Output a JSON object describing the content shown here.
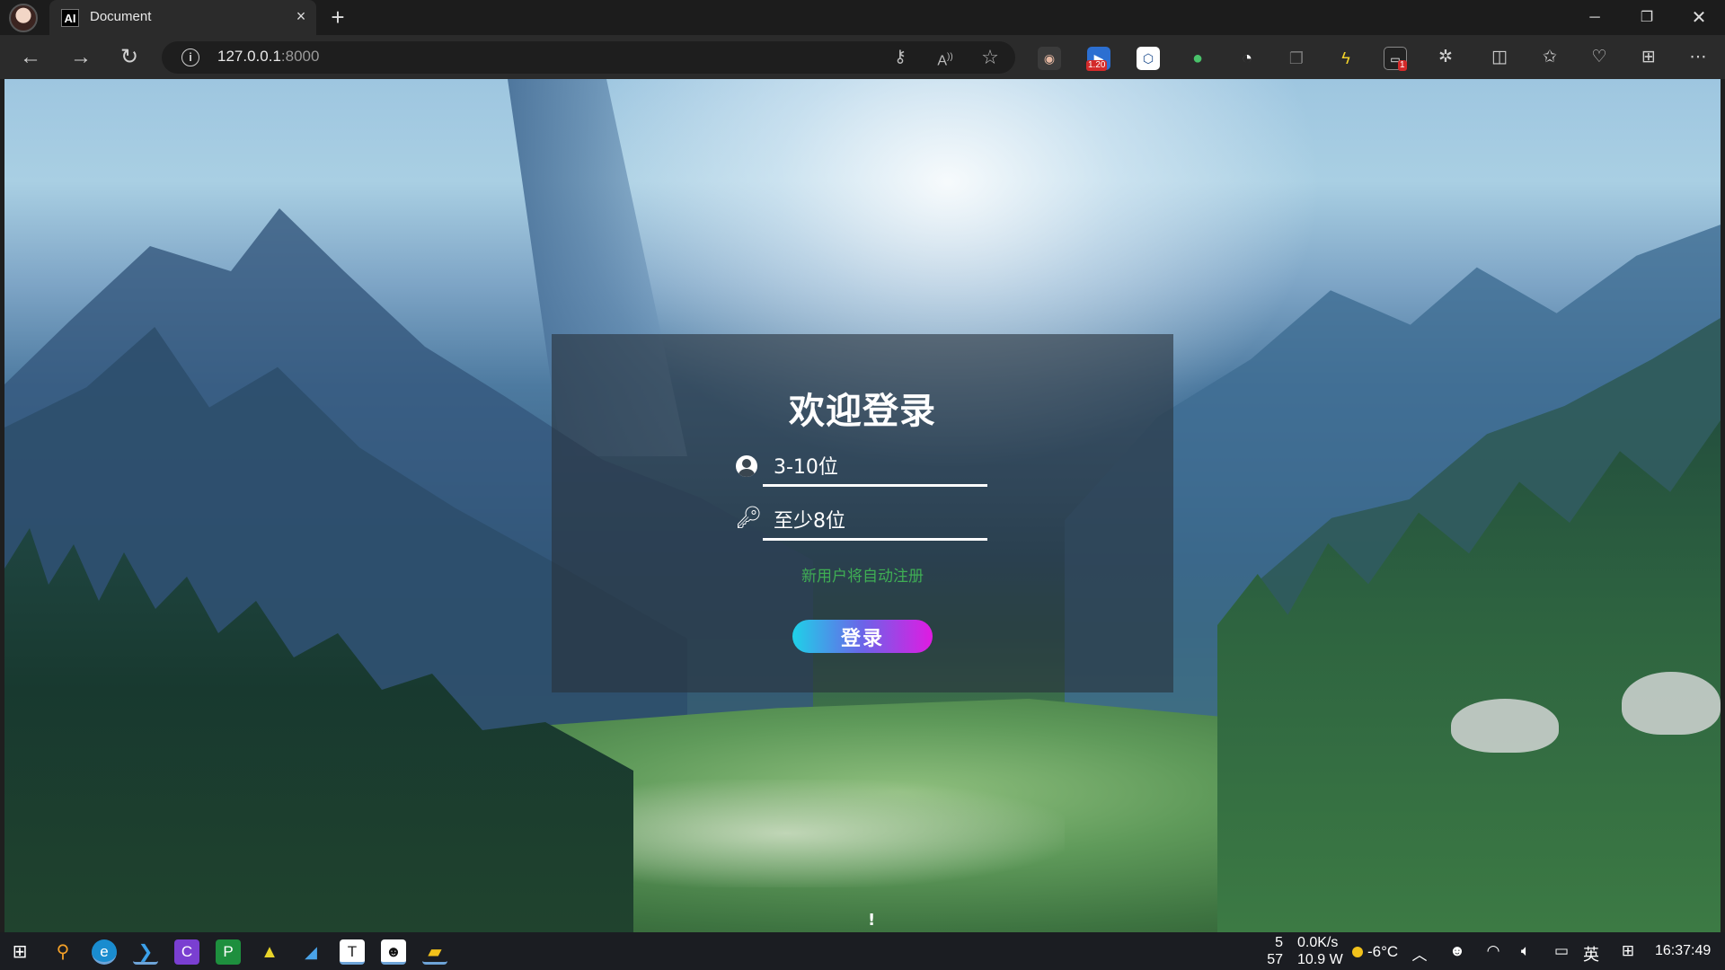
{
  "browser": {
    "tab": {
      "favicon_text": "AI",
      "title": "Document",
      "close": "×"
    },
    "new_tab": "+",
    "window": {
      "minimize": "─",
      "maximize": "❐",
      "close": "✕"
    },
    "nav": {
      "back": "←",
      "forward": "→",
      "reload": "↻"
    },
    "address": {
      "host": "127.0.0.1",
      "port": ":8000"
    },
    "extensions": [
      {
        "name": "owl-extension-icon",
        "badge": ""
      },
      {
        "name": "video-speed-extension-icon",
        "badge": "1.20"
      },
      {
        "name": "cube-extension-icon",
        "badge": ""
      },
      {
        "name": "color-extension-icon",
        "badge": ""
      },
      {
        "name": "gauge-extension-icon",
        "badge": ""
      },
      {
        "name": "copy-extension-icon",
        "badge": ""
      },
      {
        "name": "pikachu-extension-icon",
        "badge": ""
      },
      {
        "name": "screen-extension-icon",
        "badge": "1"
      }
    ]
  },
  "login": {
    "title": "欢迎登录",
    "username_placeholder": "3-10位",
    "password_placeholder": "至少8位",
    "register_hint": "新用户将自动注册",
    "submit_label": "登录"
  },
  "page_misc": {
    "exclamation": "!"
  },
  "taskbar": {
    "net_top": "5",
    "net_bottom": "57",
    "speed": "0.0K/s",
    "power": "10.9 W",
    "temperature": "-6°C",
    "ime": "英",
    "clock": "16:37:49"
  },
  "colors": {
    "register_hint": "#3fae54",
    "button_gradient": [
      "#1fd1e8",
      "#6b64e8",
      "#e01be2"
    ]
  }
}
